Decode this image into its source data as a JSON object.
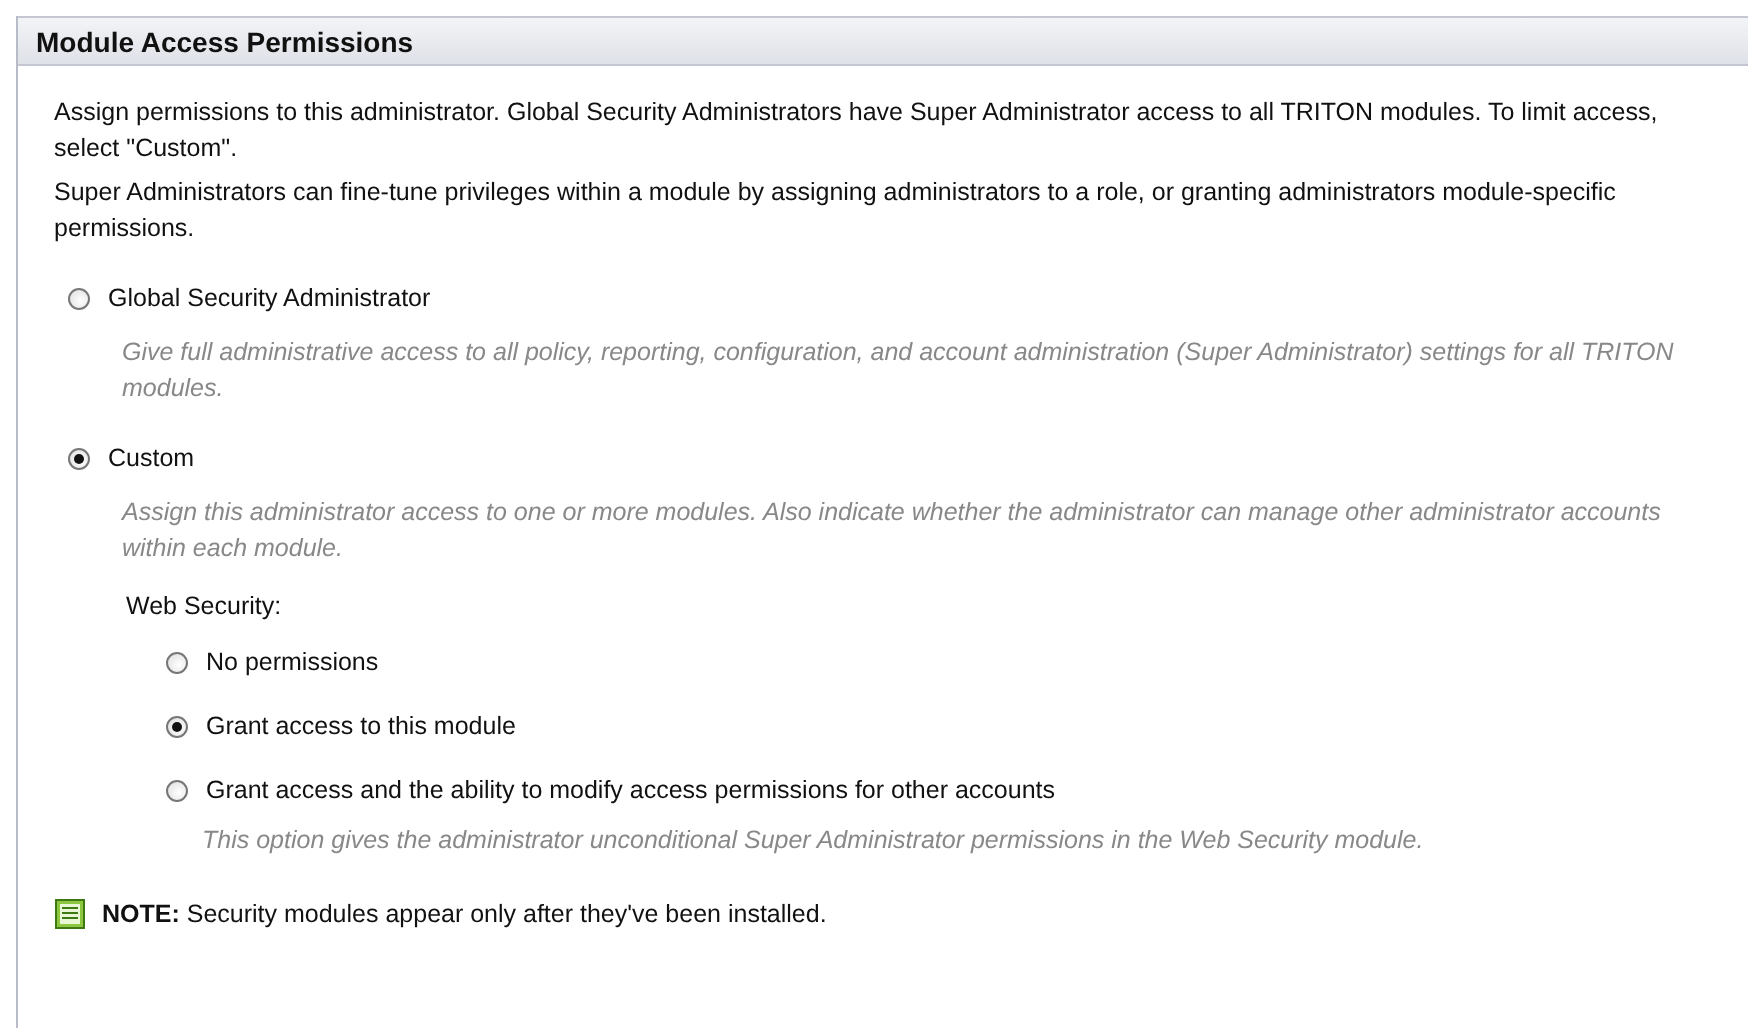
{
  "panel": {
    "title": "Module Access Permissions"
  },
  "intro": [
    "Assign permissions to this administrator. Global Security Administrators have Super Administrator access to all TRITON modules. To limit access, select \"Custom\".",
    "Super Administrators can fine-tune privileges within a module by assigning administrators to a role, or granting administrators module-specific permissions."
  ],
  "access_options": [
    {
      "label": "Global Security Administrator",
      "selected": false,
      "description": "Give full administrative access to all policy, reporting, configuration, and account administration (Super Administrator) settings for all TRITON modules."
    },
    {
      "label": "Custom",
      "selected": true,
      "description": "Assign this administrator access to one or more modules. Also indicate whether the administrator can manage other administrator accounts within each module."
    }
  ],
  "module": {
    "label": "Web Security:",
    "options": [
      {
        "label": "No permissions",
        "selected": false
      },
      {
        "label": "Grant access to this module",
        "selected": true
      },
      {
        "label": "Grant access and the ability to modify access permissions for other accounts",
        "selected": false,
        "description": "This option gives the administrator unconditional Super Administrator permissions in the Web Security module."
      }
    ]
  },
  "note": "**NOTE:** Security modules appear only after they've been installed."
}
